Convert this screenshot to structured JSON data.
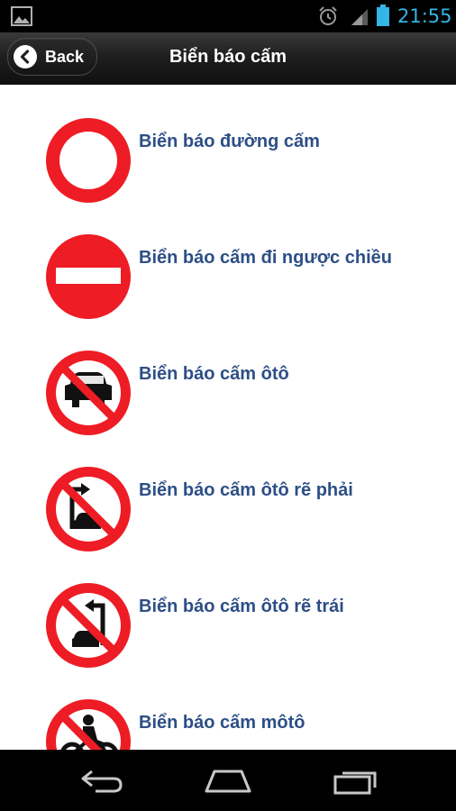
{
  "status_bar": {
    "time": "21:55",
    "icons": [
      "gallery-icon",
      "alarm-icon",
      "signal-icon",
      "battery-icon"
    ],
    "time_color": "#33b5e5"
  },
  "header": {
    "back_label": "Back",
    "title": "Biển báo cấm"
  },
  "items": [
    {
      "label": "Biển báo đường cấm",
      "icon": "no-entry-ring-sign-icon"
    },
    {
      "label": "Biển báo cấm đi ngược chiều",
      "icon": "no-entry-bar-sign-icon"
    },
    {
      "label": "Biển báo cấm ôtô",
      "icon": "no-cars-sign-icon"
    },
    {
      "label": "Biển báo cấm ôtô rẽ phải",
      "icon": "no-right-turn-cars-sign-icon"
    },
    {
      "label": "Biển báo cấm ôtô rẽ trái",
      "icon": "no-left-turn-cars-sign-icon"
    },
    {
      "label": "Biển báo cấm môtô",
      "icon": "no-motorcycles-sign-icon"
    }
  ],
  "nav": {
    "icons": [
      "back-nav-icon",
      "home-nav-icon",
      "recents-nav-icon"
    ]
  },
  "colors": {
    "sign_red": "#ee1c25",
    "label_blue": "#2d4f86"
  }
}
